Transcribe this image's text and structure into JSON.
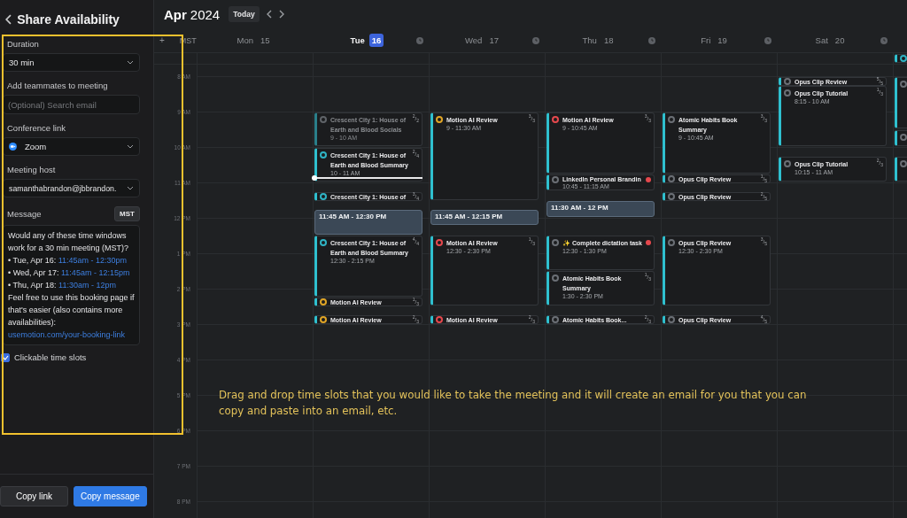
{
  "sidebar": {
    "title": "Share Availability",
    "fields": [
      {
        "kind": "select",
        "label": "Duration",
        "value": "30 min"
      },
      {
        "kind": "input",
        "label": "Add teammates to meeting",
        "placeholder": "(Optional) Search email"
      },
      {
        "kind": "app-select",
        "label": "Conference link",
        "value": "Zoom"
      },
      {
        "kind": "select",
        "label": "Meeting host",
        "value": "samanthabrandon@jbbrandon."
      }
    ],
    "message": {
      "label": "Message",
      "timezone": "MST",
      "intro": "Would any of these time windows work for a 30 min meeting (MST)?",
      "slots": [
        {
          "day": "• Tue, Apr 16:",
          "time": "11:45am - 12:30pm"
        },
        {
          "day": "• Wed, Apr 17:",
          "time": "11:45am - 12:15pm"
        },
        {
          "day": "• Thu, Apr 18:",
          "time": "11:30am - 12pm"
        }
      ],
      "outro": "Feel free to use this booking page if that's easier (also contains more availabilities):",
      "link": "usemotion.com/your-booking-link"
    },
    "checkbox": {
      "label": "Clickable time slots",
      "checked": true
    },
    "buttons": [
      {
        "label": "Copy link",
        "kind": "secondary"
      },
      {
        "label": "Copy message",
        "kind": "primary"
      }
    ]
  },
  "calendar": {
    "month": "Apr",
    "year": "2024",
    "today_button": "Today",
    "add_symbol": "+",
    "timezone": "MST",
    "days": [
      {
        "name": "Mon",
        "date": "15",
        "selected": false,
        "clock": false,
        "now_marker": false
      },
      {
        "name": "Tue",
        "date": "16",
        "selected": true,
        "clock": true,
        "now_marker": true,
        "events": [
          {
            "kind": "event",
            "title": "Crescent City 1: House of Earth and Blood Socials",
            "time": "9 - 10 AM",
            "count": "$^{2}$/$_{2}$",
            "color": "#5f6368",
            "dimmed": true,
            "alert": false
          },
          {
            "kind": "event",
            "title": "Crescent City 1: House of Earth and Blood Summary",
            "time": "10 - 11 AM",
            "count": "$^{2}$/$_{4}$",
            "color": "#2fb3c4",
            "dimmed": false,
            "alert": false
          },
          {
            "kind": "event",
            "title": "Crescent City 1: House of",
            "count": "$^{3}$/$_{4}$",
            "color": "#2fb3c4",
            "dimmed": false,
            "alert": false
          },
          {
            "kind": "slot",
            "label": "11:45 AM - 12:30 PM"
          },
          {
            "kind": "event",
            "title": "Crescent City 1: House of Earth and Blood Summary",
            "time": "12:30 - 2:15 PM",
            "count": "$^{4}$/$_{4}$",
            "color": "#2fb3c4",
            "dimmed": false,
            "alert": false
          },
          {
            "kind": "event",
            "title": "Motion AI Review",
            "count": "$^{1}$/$_{3}$",
            "color": "#e0a526",
            "dimmed": false,
            "alert": false
          },
          {
            "kind": "event",
            "title": "Motion AI Review",
            "count": "$^{2}$/$_{3}$",
            "color": "#e0a526",
            "dimmed": false,
            "alert": false
          }
        ]
      },
      {
        "name": "Wed",
        "date": "17",
        "selected": false,
        "clock": true,
        "now_marker": false,
        "events": [
          {
            "kind": "event",
            "title": "Motion AI Review",
            "time": "9 - 11:30 AM",
            "count": "$^{3}$/$_{3}$",
            "color": "#e0a526",
            "dimmed": false,
            "alert": false
          },
          {
            "kind": "slot",
            "label": "11:45 AM - 12:15 PM"
          },
          {
            "kind": "event",
            "title": "Motion AI Review",
            "time": "12:30 - 2:30 PM",
            "count": "$^{1}$/$_{3}$",
            "color": "#e5484d",
            "dimmed": false,
            "alert": false
          },
          {
            "kind": "event",
            "title": "Motion AI Review",
            "count": "$^{2}$/$_{3}$",
            "color": "#e5484d",
            "dimmed": false,
            "alert": false
          }
        ]
      },
      {
        "name": "Thu",
        "date": "18",
        "selected": false,
        "clock": true,
        "now_marker": false,
        "events": [
          {
            "kind": "event",
            "title": "Motion AI Review",
            "time": "9 - 10:45 AM",
            "count": "$^{3}$/$_{3}$",
            "color": "#e5484d",
            "dimmed": false,
            "alert": false
          },
          {
            "kind": "event",
            "title": "LinkedIn Personal Brandin",
            "time": "10:45 - 11:15 AM",
            "color": "#6b6f75",
            "dimmed": false,
            "alert": true
          },
          {
            "kind": "slot",
            "label": "11:30 AM - 12 PM"
          },
          {
            "kind": "event",
            "title": "✨ Complete dictation task",
            "time": "12:30 - 1:30 PM",
            "color": "#6b6f75",
            "dimmed": false,
            "alert": true
          },
          {
            "kind": "event",
            "title": "Atomic Habits Book Summary",
            "time": "1:30 - 2:30 PM",
            "count": "$^{1}$/$_{3}$",
            "color": "#6b6f75",
            "dimmed": false,
            "alert": false
          },
          {
            "kind": "event",
            "title": "Atomic Habits Book...",
            "count": "$^{2}$/$_{3}$",
            "color": "#6b6f75",
            "dimmed": false,
            "alert": false
          }
        ]
      },
      {
        "name": "Fri",
        "date": "19",
        "selected": false,
        "clock": true,
        "now_marker": false,
        "events": [
          {
            "kind": "event",
            "title": "Atomic Habits Book Summary",
            "time": "9 - 10:45 AM",
            "count": "$^{3}$/$_{3}$",
            "color": "#6b6f75",
            "dimmed": false,
            "alert": false
          },
          {
            "kind": "event",
            "title": "Opus Clip Review",
            "count": "$^{1}$/$_{5}$",
            "color": "#6b6f75",
            "dimmed": false,
            "alert": false
          },
          {
            "kind": "event",
            "title": "Opus Clip Review",
            "count": "$^{2}$/$_{5}$",
            "color": "#6b6f75",
            "dimmed": false,
            "alert": false
          },
          {
            "kind": "event",
            "title": "Opus Clip Review",
            "time": "12:30 - 2:30 PM",
            "count": "$^{3}$/$_{5}$",
            "color": "#6b6f75",
            "dimmed": false,
            "alert": false
          },
          {
            "kind": "event",
            "title": "Opus Clip Review",
            "count": "$^{4}$/$_{5}$",
            "color": "#6b6f75",
            "dimmed": false,
            "alert": false
          }
        ]
      },
      {
        "name": "Sat",
        "date": "20",
        "selected": false,
        "clock": true,
        "now_marker": false,
        "events": [
          {
            "kind": "event",
            "title": "Opus Clip Review",
            "count": "$^{5}$/$_{5}$",
            "color": "#6b6f75",
            "dimmed": false,
            "alert": false
          },
          {
            "kind": "event",
            "title": "Opus Clip Tutorial",
            "time": "8:15 - 10 AM",
            "count": "$^{1}$/$_{3}$",
            "color": "#6b6f75",
            "dimmed": false,
            "alert": false
          },
          {
            "kind": "event",
            "title": "Opus Clip Tutorial",
            "time": "10:15 - 11 AM",
            "count": "$^{2}$/$_{3}$",
            "color": "#6b6f75",
            "dimmed": false,
            "alert": false
          }
        ]
      }
    ],
    "partial_day": {
      "all_day": [
        {
          "color": "#2fb3c4"
        }
      ],
      "events": [
        {
          "color": "#6b6f75"
        },
        {
          "color": "#6b6f75"
        },
        {
          "color": "#6b6f75"
        }
      ]
    },
    "hours": [
      "8 AM",
      "9 AM",
      "10 AM",
      "11 AM",
      "12 PM",
      "1 PM",
      "2 PM",
      "3 PM",
      "4 PM",
      "5 PM",
      "6 PM",
      "7 PM",
      "8 PM"
    ]
  },
  "annotation": "Drag and drop time slots that you would like to take the meeting and it will create an email for you that you can copy and paste into an email, etc."
}
